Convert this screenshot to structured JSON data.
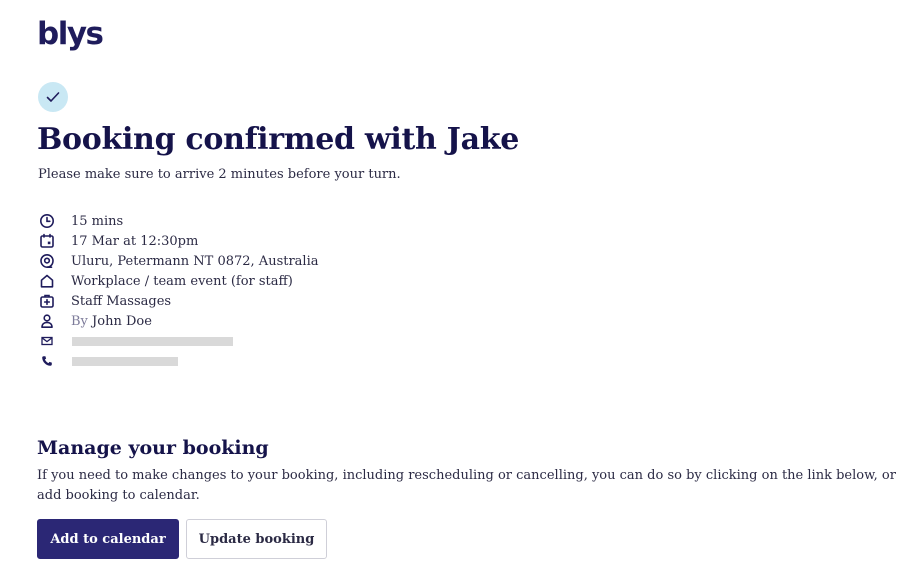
{
  "brand": {
    "logo_text": "blys",
    "primary_color": "#2b2775",
    "badge_color": "#c9e8f4"
  },
  "header": {
    "title": "Booking confirmed with Jake",
    "subtitle": "Please make sure to arrive 2 minutes before your turn."
  },
  "details": {
    "duration": {
      "icon": "clock-icon",
      "text": "15 mins"
    },
    "datetime": {
      "icon": "calendar-icon",
      "text": "17 Mar at 12:30pm"
    },
    "location": {
      "icon": "location-pin-icon",
      "text": "Uluru, Petermann NT 0872, Australia"
    },
    "venue": {
      "icon": "home-icon",
      "text": "Workplace / team event (for staff)"
    },
    "service": {
      "icon": "medical-kit-icon",
      "text": "Staff Massages"
    },
    "booked_by": {
      "icon": "user-icon",
      "prefix": "By",
      "name": "John Doe"
    },
    "email": {
      "icon": "mail-icon"
    },
    "phone": {
      "icon": "phone-icon"
    }
  },
  "manage": {
    "title": "Manage your booking",
    "text": "If you need to make changes to your booking, including rescheduling or cancelling, you can do so by clicking on the link below, or add booking to calendar."
  },
  "actions": {
    "add_to_calendar_label": "Add to calendar",
    "update_booking_label": "Update booking"
  }
}
